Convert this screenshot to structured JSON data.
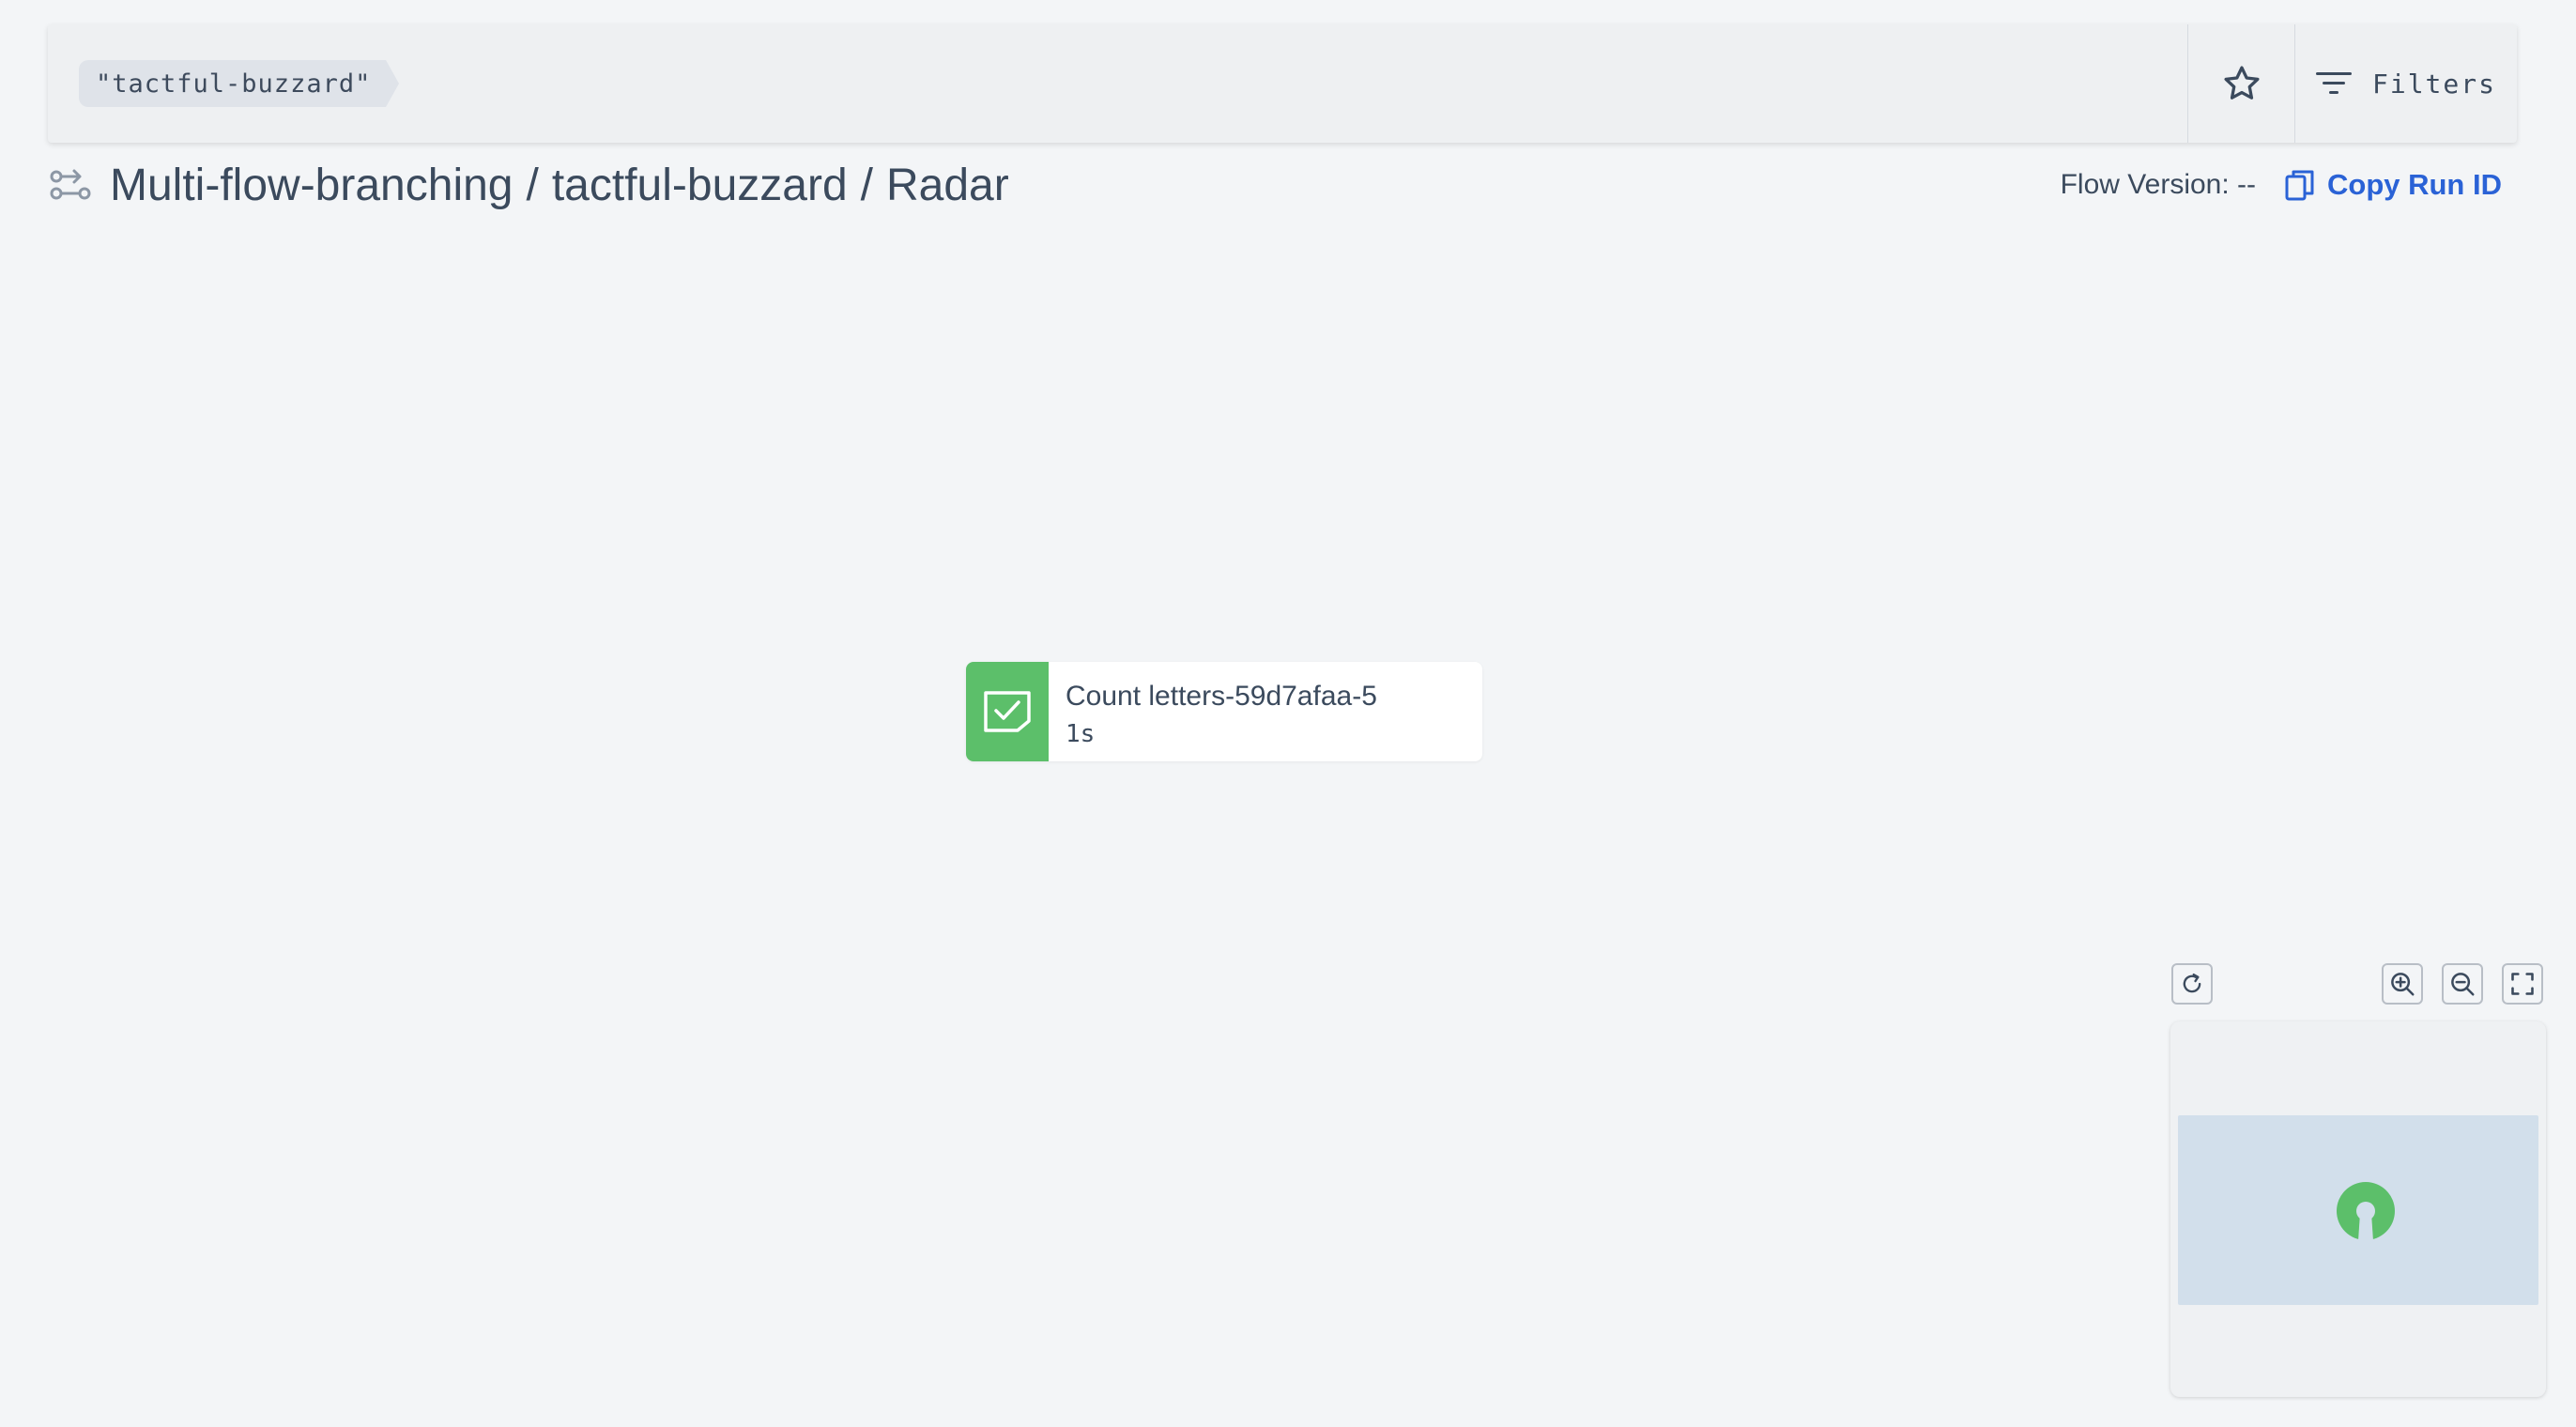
{
  "search": {
    "chip_text": "\"tactful-buzzard\""
  },
  "toolbar": {
    "favorite_icon": "star-icon",
    "filters_label": "Filters",
    "filters_icon": "filter-lines-icon"
  },
  "header": {
    "flow_icon": "flow-run-icon",
    "breadcrumb": {
      "flow": "Multi-flow-branching",
      "run": "tactful-buzzard",
      "view": "Radar",
      "separator": "/"
    },
    "flow_version_label": "Flow Version: --",
    "copy_run_id_label": "Copy Run ID",
    "copy_icon": "copy-icon"
  },
  "graph": {
    "node": {
      "title": "Count letters-59d7afaa-5",
      "duration": "1s",
      "status": "completed",
      "status_color": "#5cbf6a",
      "status_icon": "check-task-icon"
    }
  },
  "controls": {
    "recenter_icon": "refresh-icon",
    "zoom_in_icon": "zoom-in-icon",
    "zoom_out_icon": "zoom-out-icon",
    "fullscreen_icon": "fullscreen-icon"
  },
  "minimap": {
    "node_color": "#5cbf6a",
    "viewport_color": "#d2dfeb"
  },
  "colors": {
    "accent": "#2a62d6",
    "text": "#3b4a5d",
    "background": "#f3f5f7"
  }
}
